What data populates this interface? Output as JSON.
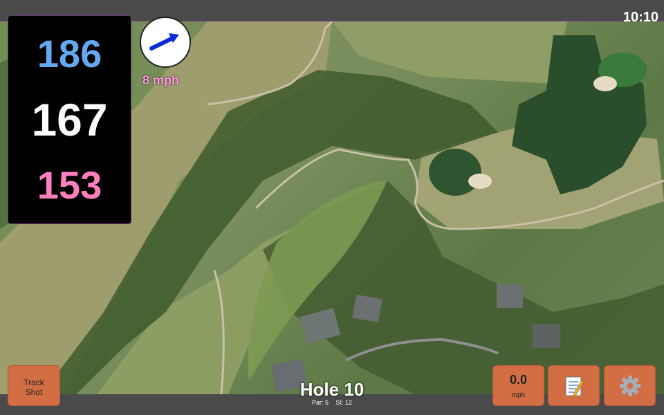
{
  "status_bar": {
    "time": "10:10"
  },
  "yardage": {
    "back": "186",
    "center": "167",
    "front": "153"
  },
  "wind": {
    "speed_text": "8 mph",
    "icon": "wind-arrow-icon"
  },
  "buttons": {
    "track_shot_line1": "Track",
    "track_shot_line2": "Shot",
    "speed_value": "0.0",
    "speed_unit": "mph",
    "notes_icon": "notepad-icon",
    "settings_icon": "gear-icon"
  },
  "hole": {
    "title": "Hole 10",
    "par": "Par: 5",
    "si": "SI: 12"
  },
  "colors": {
    "accent_button": "#d26d44",
    "back_yardage": "#64a8f0",
    "front_yardage": "#ff7fbf",
    "wind_text": "#ff9be0"
  }
}
